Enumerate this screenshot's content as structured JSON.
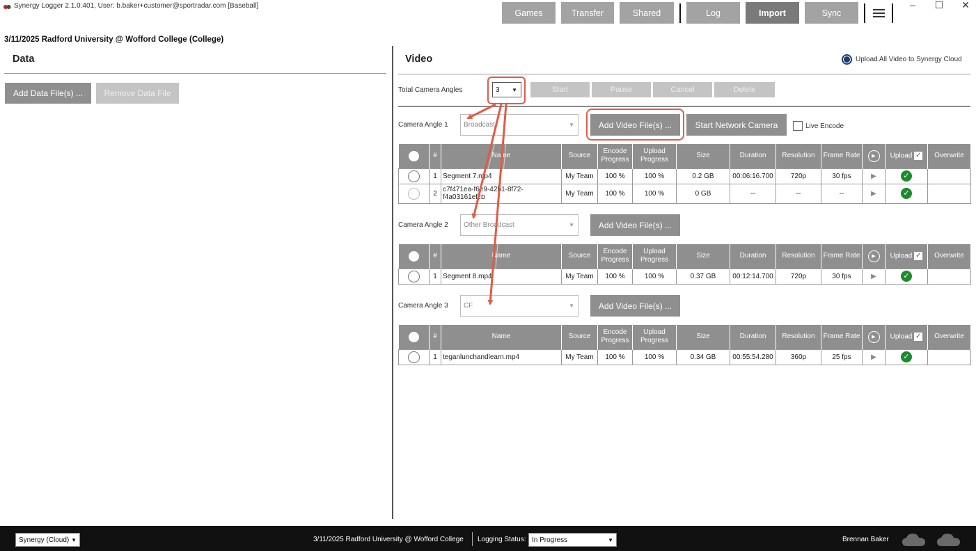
{
  "title_bar": {
    "title": "Synergy Logger 2.1.0.401, User: b.baker+customer@sportradar.com [Baseball]",
    "nav": [
      "Games",
      "Transfer",
      "Shared",
      "Log",
      "Import",
      "Sync"
    ],
    "active_nav": "Import",
    "window_controls": {
      "minimize": "–",
      "maximize": "☐",
      "close": "✕"
    }
  },
  "game_header": "3/11/2025 Radford University @ Wofford College (College)",
  "data_panel": {
    "title": "Data",
    "add_button": "Add Data File(s) ...",
    "remove_button": "Remove Data File"
  },
  "video_panel": {
    "title": "Video",
    "upload_all_label": "Upload All Video to Synergy Cloud",
    "total_angles_label": "Total Camera Angles",
    "total_angles_value": "3",
    "controls": [
      "Start",
      "Pause",
      "Cancel",
      "Delete"
    ],
    "start_network_camera": "Start Network Camera",
    "live_encode": "Live Encode",
    "add_video_label": "Add Video File(s) ...",
    "columns": [
      "#",
      "Name",
      "Source",
      "Encode Progress",
      "Upload Progress",
      "Size",
      "Duration",
      "Resolution",
      "Frame Rate",
      "Upload",
      "Overwrite"
    ],
    "angles": [
      {
        "label": "Camera Angle 1",
        "camera": "Broadcast",
        "rows": [
          {
            "num": "1",
            "name": "Segment 7.mp4",
            "source": "My Team",
            "encode": "100 %",
            "upload": "100 %",
            "size": "0.2 GB",
            "duration": "00:06:16.700",
            "resolution": "720p",
            "frame_rate": "30 fps"
          },
          {
            "num": "2",
            "name": "c7f471ea-f6b9-42b1-8f72-f4a03161efcb",
            "source": "My Team",
            "encode": "100 %",
            "upload": "100 %",
            "size": "0 GB",
            "duration": "--",
            "resolution": "--",
            "frame_rate": "--"
          }
        ]
      },
      {
        "label": "Camera Angle 2",
        "camera": "Other Broadcast",
        "rows": [
          {
            "num": "1",
            "name": "Segment 8.mp4",
            "source": "My Team",
            "encode": "100 %",
            "upload": "100 %",
            "size": "0.37 GB",
            "duration": "00:12:14.700",
            "resolution": "720p",
            "frame_rate": "30 fps"
          }
        ]
      },
      {
        "label": "Camera Angle 3",
        "camera": "CF",
        "rows": [
          {
            "num": "1",
            "name": "teganlunchandlearn.mp4",
            "source": "My Team",
            "encode": "100 %",
            "upload": "100 %",
            "size": "0.34 GB",
            "duration": "00:55:54.280",
            "resolution": "360p",
            "frame_rate": "25 fps"
          }
        ]
      }
    ]
  },
  "status_bar": {
    "account": "Synergy (Cloud)",
    "game": "3/11/2025 Radford University @ Wofford College",
    "logging_status_label": "Logging Status:",
    "logging_status": "In Progress",
    "user": "Brennan  Baker"
  },
  "colors": {
    "button_gray": "#8f8f8f",
    "active_nav": "#7a7a7a",
    "annotation_red": "#e25b45",
    "ok_green": "#1e8a2f",
    "status_bar": "#111111"
  }
}
